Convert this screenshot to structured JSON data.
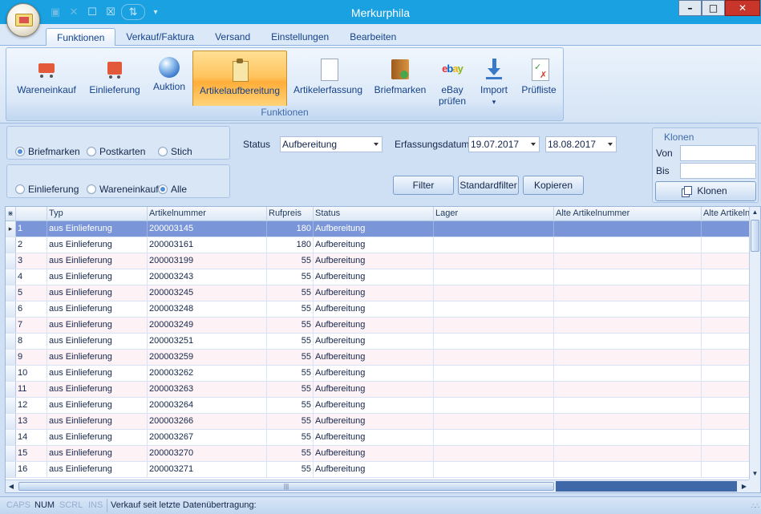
{
  "window": {
    "title": "Merkurphila",
    "minimize": "–",
    "maximize": "□",
    "close": "✕"
  },
  "qat": {
    "icons": [
      "save-icon",
      "delete-icon",
      "new-document-icon",
      "delete-document-icon",
      "sort-icon",
      "customize-dropdown-icon"
    ],
    "glyphs": [
      "▣",
      "✕",
      "☐",
      "☒",
      "⇅",
      "▾"
    ]
  },
  "tabs": [
    "Funktionen",
    "Verkauf/Faktura",
    "Versand",
    "Einstellungen",
    "Bearbeiten"
  ],
  "active_tab": "Funktionen",
  "ribbon": {
    "group_label": "Funktionen",
    "buttons": [
      {
        "label": "Wareneinkauf",
        "icon": "shopping-cart-icon"
      },
      {
        "label": "Einlieferung",
        "icon": "parcel-cart-icon"
      },
      {
        "label": "Auktion",
        "icon": "globe-icon"
      },
      {
        "label": "Artikelaufbereitung",
        "icon": "clipboard-icon"
      },
      {
        "label": "Artikelerfassung",
        "icon": "blank-document-icon"
      },
      {
        "label": "Briefmarken",
        "icon": "stamp-album-icon"
      },
      {
        "label": "eBay",
        "label2": "prüfen",
        "icon": "ebay-logo-icon"
      },
      {
        "label": "Import",
        "label2": "▾",
        "icon": "import-arrow-icon"
      },
      {
        "label": "Prüfliste",
        "icon": "checklist-icon"
      }
    ],
    "ebay_logo": {
      "e": "e",
      "b": "b",
      "a": "a",
      "y": "y"
    },
    "active_button": "Artikelaufbereitung"
  },
  "filters": {
    "type_radios": [
      {
        "label": "Briefmarken",
        "checked": true
      },
      {
        "label": "Postkarten",
        "checked": false
      },
      {
        "label": "Stich",
        "checked": false
      }
    ],
    "source_radios": [
      {
        "label": "Einlieferung",
        "checked": false
      },
      {
        "label": "Wareneinkauf",
        "checked": false
      },
      {
        "label": "Alle",
        "checked": true
      }
    ],
    "status_label": "Status",
    "status_value": "Aufbereitung",
    "date_label": "Erfassungsdatum",
    "date_from": "19.07.2017",
    "date_to": "18.08.2017",
    "filter_button": "Filter",
    "standard_filter_button": "Standardfilter",
    "copy_button": "Kopieren"
  },
  "klonen": {
    "title": "Klonen",
    "von_label": "Von",
    "von_value": "",
    "bis_label": "Bis",
    "bis_value": "",
    "button": "Klonen"
  },
  "grid": {
    "corner_glyph": "⋇",
    "columns": [
      "Typ",
      "Artikelnummer",
      "Rufpreis",
      "Status",
      "Lager",
      "Alte Artikelnummer",
      "Alte Artikelnu"
    ],
    "selected_row_index": 0,
    "current_row_marker": "▸",
    "rows": [
      {
        "nr": "1",
        "typ": "aus Einlieferung",
        "artikelnummer": "200003145",
        "rufpreis": "180",
        "status": "Aufbereitung"
      },
      {
        "nr": "2",
        "typ": "aus Einlieferung",
        "artikelnummer": "200003161",
        "rufpreis": "180",
        "status": "Aufbereitung"
      },
      {
        "nr": "3",
        "typ": "aus Einlieferung",
        "artikelnummer": "200003199",
        "rufpreis": "55",
        "status": "Aufbereitung"
      },
      {
        "nr": "4",
        "typ": "aus Einlieferung",
        "artikelnummer": "200003243",
        "rufpreis": "55",
        "status": "Aufbereitung"
      },
      {
        "nr": "5",
        "typ": "aus Einlieferung",
        "artikelnummer": "200003245",
        "rufpreis": "55",
        "status": "Aufbereitung"
      },
      {
        "nr": "6",
        "typ": "aus Einlieferung",
        "artikelnummer": "200003248",
        "rufpreis": "55",
        "status": "Aufbereitung"
      },
      {
        "nr": "7",
        "typ": "aus Einlieferung",
        "artikelnummer": "200003249",
        "rufpreis": "55",
        "status": "Aufbereitung"
      },
      {
        "nr": "8",
        "typ": "aus Einlieferung",
        "artikelnummer": "200003251",
        "rufpreis": "55",
        "status": "Aufbereitung"
      },
      {
        "nr": "9",
        "typ": "aus Einlieferung",
        "artikelnummer": "200003259",
        "rufpreis": "55",
        "status": "Aufbereitung"
      },
      {
        "nr": "10",
        "typ": "aus Einlieferung",
        "artikelnummer": "200003262",
        "rufpreis": "55",
        "status": "Aufbereitung"
      },
      {
        "nr": "11",
        "typ": "aus Einlieferung",
        "artikelnummer": "200003263",
        "rufpreis": "55",
        "status": "Aufbereitung"
      },
      {
        "nr": "12",
        "typ": "aus Einlieferung",
        "artikelnummer": "200003264",
        "rufpreis": "55",
        "status": "Aufbereitung"
      },
      {
        "nr": "13",
        "typ": "aus Einlieferung",
        "artikelnummer": "200003266",
        "rufpreis": "55",
        "status": "Aufbereitung"
      },
      {
        "nr": "14",
        "typ": "aus Einlieferung",
        "artikelnummer": "200003267",
        "rufpreis": "55",
        "status": "Aufbereitung"
      },
      {
        "nr": "15",
        "typ": "aus Einlieferung",
        "artikelnummer": "200003270",
        "rufpreis": "55",
        "status": "Aufbereitung"
      },
      {
        "nr": "16",
        "typ": "aus Einlieferung",
        "artikelnummer": "200003271",
        "rufpreis": "55",
        "status": "Aufbereitung"
      }
    ]
  },
  "scrollbars": {
    "up": "▲",
    "down": "▼",
    "left": "◀",
    "right": "▶",
    "grip": "|||"
  },
  "statusbar": {
    "caps": "CAPS",
    "num": "NUM",
    "scrl": "SCRL",
    "ins": "INS",
    "message": "Verkauf seit letzte Datenübertragung:",
    "grip": "∴∴"
  },
  "colors": {
    "titlebar": "#1aa1e1",
    "selected_row": "#7a96d8",
    "active_ribbon_button": "#ffc45e"
  }
}
